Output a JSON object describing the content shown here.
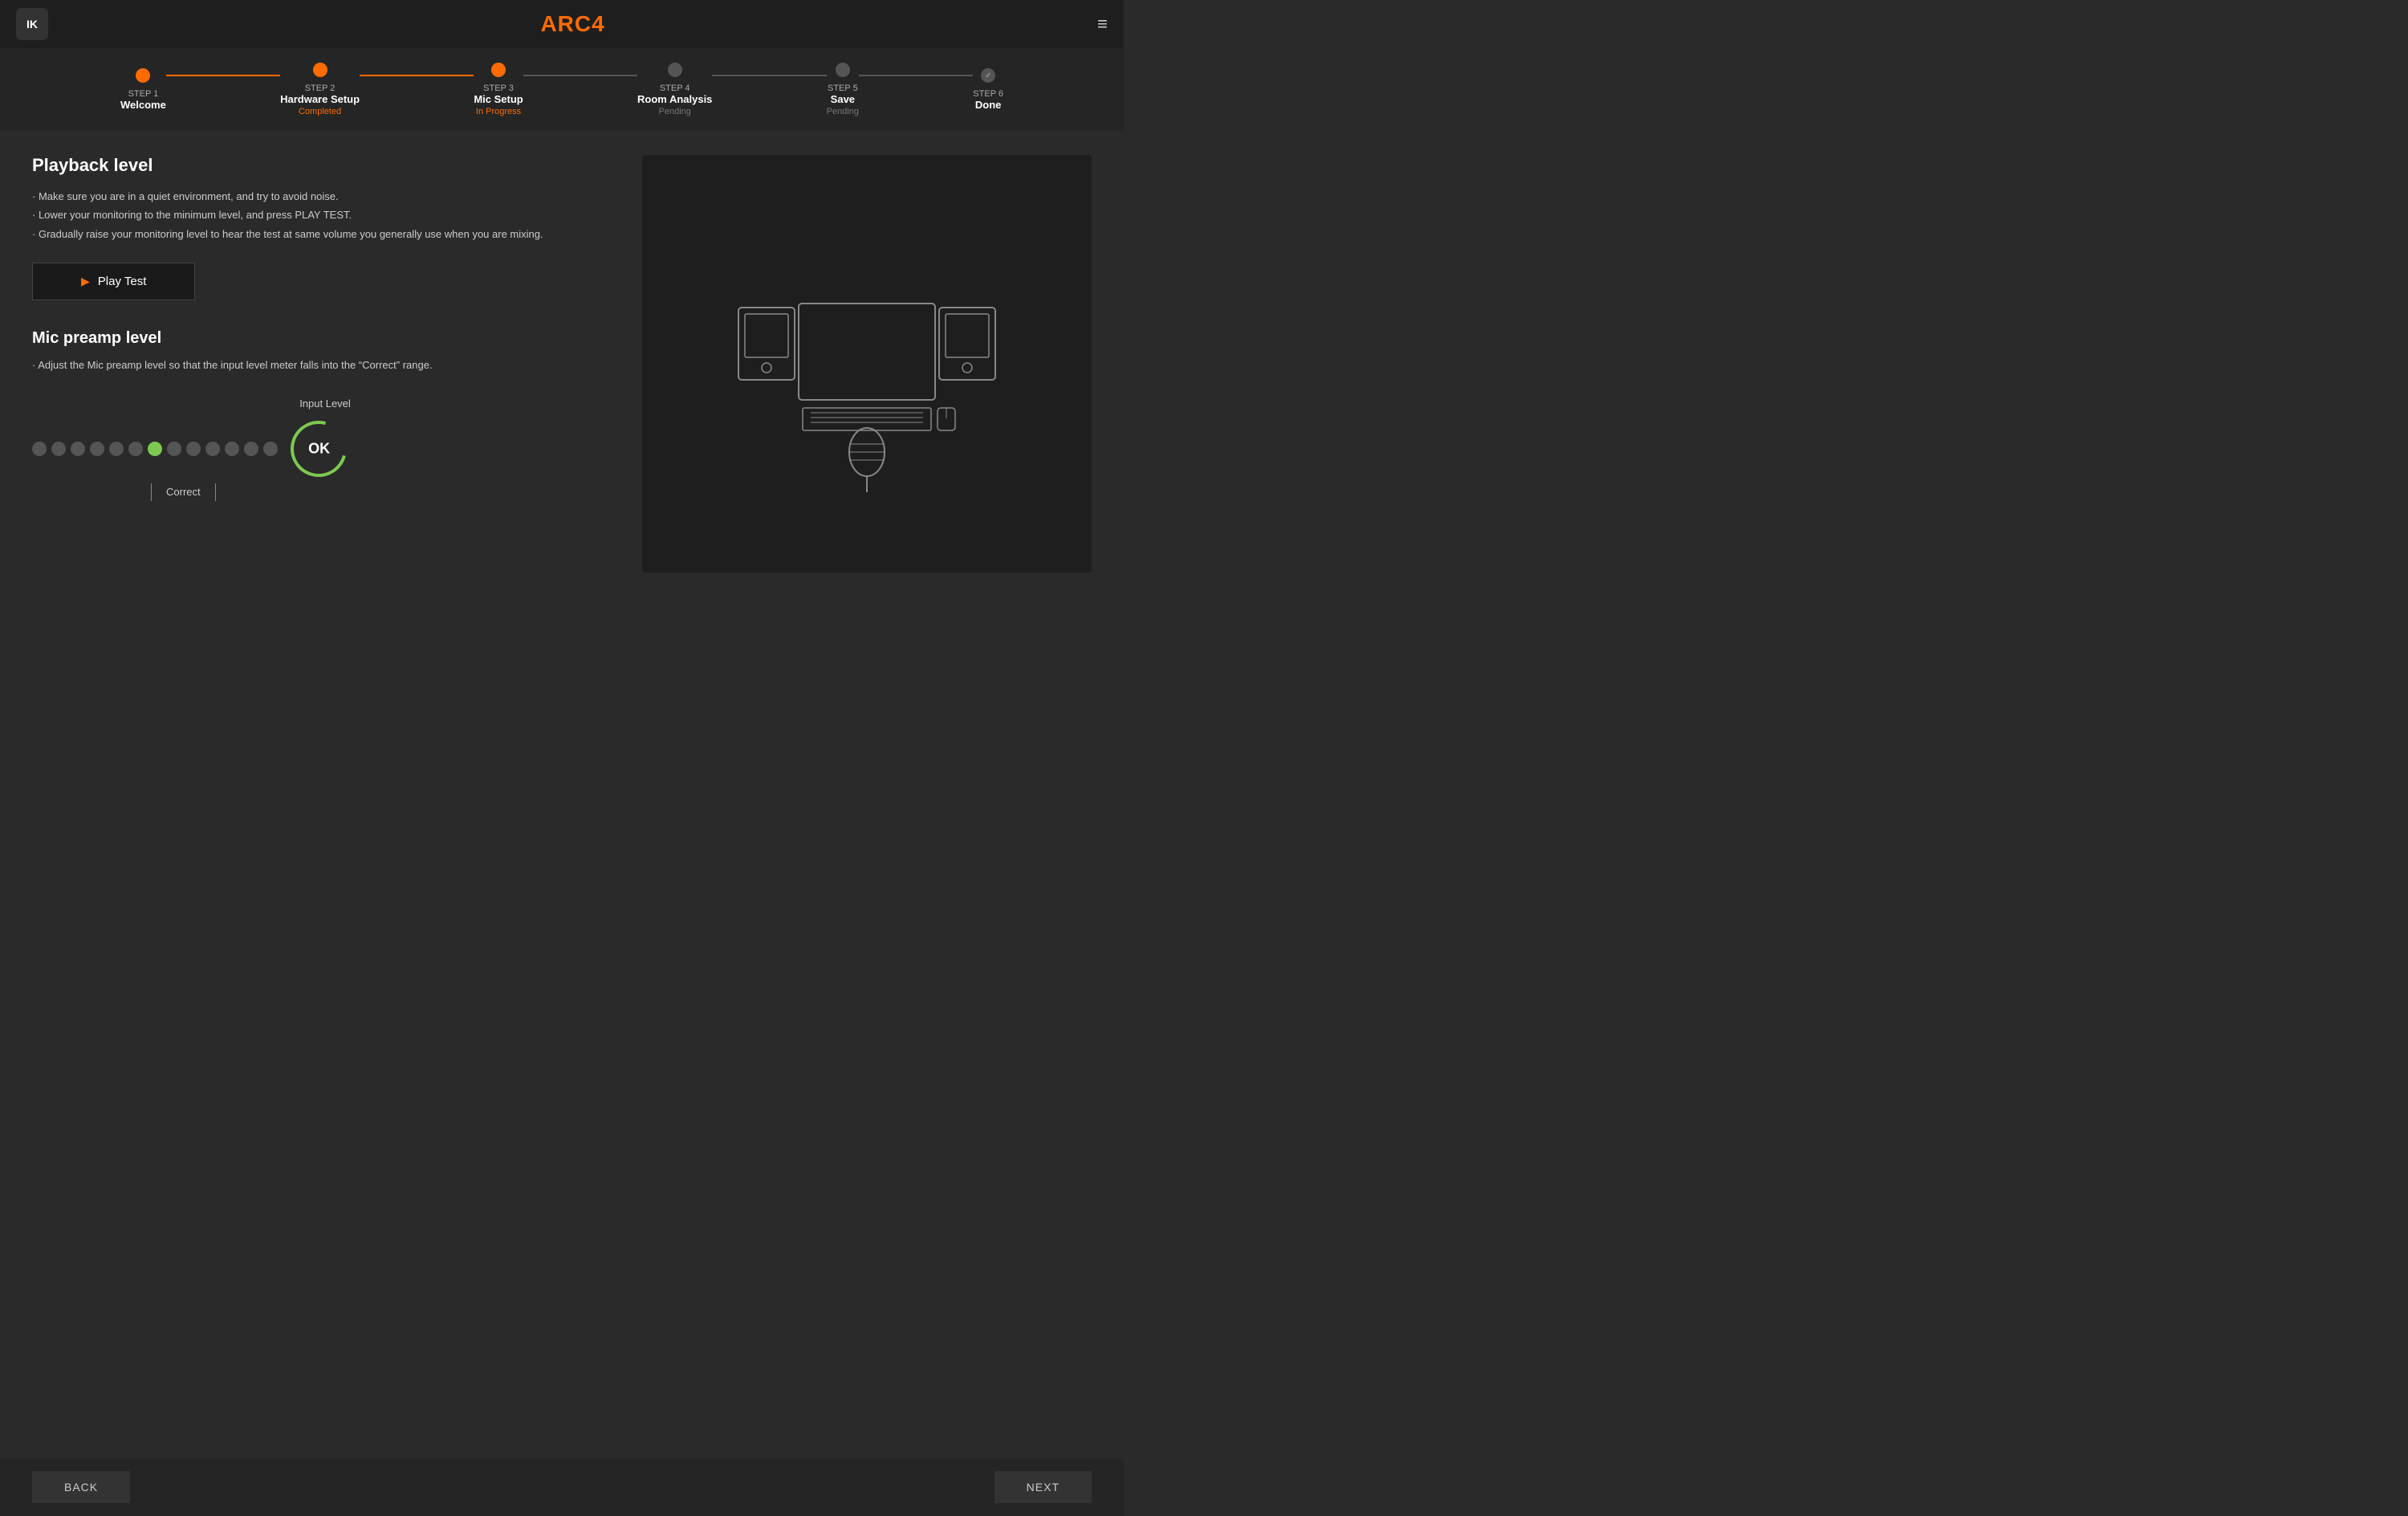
{
  "header": {
    "logo": "IK",
    "title": "ARC",
    "title_num": "4",
    "menu_icon": "≡"
  },
  "stepper": {
    "steps": [
      {
        "num": "STEP 1",
        "name": "Welcome",
        "status": "",
        "state": "completed"
      },
      {
        "num": "STEP 2",
        "name": "Hardware Setup",
        "status": "Completed",
        "state": "completed"
      },
      {
        "num": "STEP 3",
        "name": "Mic Setup",
        "status": "In Progress",
        "state": "active"
      },
      {
        "num": "STEP 4",
        "name": "Room Analysis",
        "status": "Pending",
        "state": "pending"
      },
      {
        "num": "STEP 5",
        "name": "Save",
        "status": "Pending",
        "state": "pending"
      },
      {
        "num": "STEP 6",
        "name": "Done",
        "status": "",
        "state": "done"
      }
    ]
  },
  "playback": {
    "title": "Playback level",
    "instructions": [
      "Make sure you are in a quiet environment, and try to avoid noise.",
      "Lower your monitoring to the minimum level, and press PLAY TEST.",
      "Gradually raise your monitoring level to hear the test at same volume you generally use when you are mixing."
    ],
    "play_button": "Play Test"
  },
  "mic_preamp": {
    "title": "Mic preamp level",
    "instructions": [
      "Adjust the Mic preamp level so that the input level meter falls into the “Correct” range."
    ],
    "input_level_label": "Input Level",
    "ok_label": "OK",
    "correct_label": "Correct",
    "dots_total": 13,
    "active_dot": 7
  },
  "footer": {
    "back_label": "BACK",
    "next_label": "NEXT"
  }
}
